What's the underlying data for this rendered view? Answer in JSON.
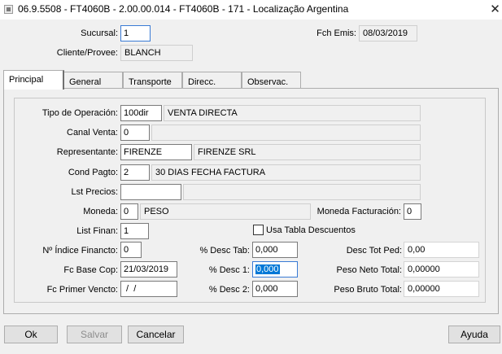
{
  "window": {
    "title": "06.9.5508 - FT4060B - 2.00.00.014 - FT4060B - 171 - Localização Argentina",
    "close_glyph": "✕"
  },
  "header": {
    "sucursal_label": "Sucursal:",
    "sucursal_value": "1",
    "fch_emis_label": "Fch Emis:",
    "fch_emis_value": "08/03/2019",
    "cliente_label": "Cliente/Provee:",
    "cliente_value": "BLANCH"
  },
  "tabs": [
    {
      "label": "Principal",
      "active": true
    },
    {
      "label": "General",
      "active": false
    },
    {
      "label": "Transporte",
      "active": false
    },
    {
      "label": "Direcc.",
      "active": false
    },
    {
      "label": "Observac.",
      "active": false
    }
  ],
  "form": {
    "tipo_operacion": {
      "label": "Tipo de Operación:",
      "code": "100dir",
      "desc": "VENTA  DIRECTA"
    },
    "canal_venta": {
      "label": "Canal Venta:",
      "code": "0",
      "desc": ""
    },
    "representante": {
      "label": "Representante:",
      "code": "FIRENZE",
      "desc": "FIRENZE SRL"
    },
    "cond_pagto": {
      "label": "Cond Pagto:",
      "code": "2",
      "desc": "30 DIAS FECHA FACTURA"
    },
    "lst_precios": {
      "label": "Lst Precios:",
      "code": "",
      "desc": ""
    },
    "moneda": {
      "label": "Moneda:",
      "code": "0",
      "desc": "PESO"
    },
    "moneda_facturacion": {
      "label": "Moneda Facturación:",
      "value": "0"
    },
    "list_finan": {
      "label": "List Finan:",
      "value": "1"
    },
    "usa_tabla": {
      "label": "Usa Tabla Descuentos",
      "checked": false
    },
    "indice_financto": {
      "label": "Nº Índice Financto:",
      "value": "0"
    },
    "fc_base_cop": {
      "label": "Fc Base Cop:",
      "value": "21/03/2019"
    },
    "fc_primer_vencto": {
      "label": "Fc Primer Vencto:",
      "value": " /  /"
    },
    "desc_tab": {
      "label": "% Desc Tab:",
      "value": "0,000"
    },
    "desc_1": {
      "label": "% Desc 1:",
      "value": "0,000"
    },
    "desc_2": {
      "label": "% Desc 2:",
      "value": "0,000"
    },
    "desc_tot_ped": {
      "label": "Desc Tot Ped:",
      "value": "0,00"
    },
    "peso_neto": {
      "label": "Peso Neto Total:",
      "value": "0,00000"
    },
    "peso_bruto": {
      "label": "Peso Bruto Total:",
      "value": "0,00000"
    }
  },
  "buttons": {
    "ok": "Ok",
    "salvar": "Salvar",
    "cancelar": "Cancelar",
    "ayuda": "Ayuda"
  }
}
